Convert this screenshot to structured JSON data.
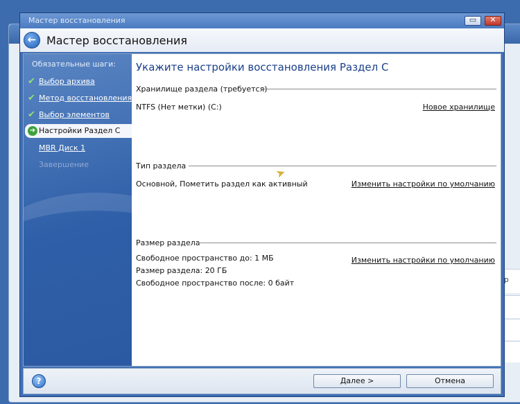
{
  "window": {
    "title": "Мастер восстановления",
    "header_title": "Мастер восстановления"
  },
  "background_window": {
    "fragment": "бр"
  },
  "sidebar": {
    "heading": "Обязательные шаги:",
    "items": [
      {
        "label": "Выбор архива",
        "state": "done"
      },
      {
        "label": "Метод восстановления",
        "state": "done"
      },
      {
        "label": "Выбор элементов",
        "state": "done"
      },
      {
        "label": "Настройки Раздел C",
        "state": "active"
      },
      {
        "label": "MBR Диск 1",
        "state": "pending"
      },
      {
        "label": "Завершение",
        "state": "disabled"
      }
    ]
  },
  "main": {
    "title": "Укажите настройки восстановления Раздел C",
    "storage": {
      "heading": "Хранилище раздела (требуется)",
      "value": "NTFS (Нет метки) (C:)",
      "link": "Новое хранилище"
    },
    "type": {
      "heading": "Тип раздела",
      "value": "Основной, Пометить раздел как активный",
      "link": "Изменить настройки по умолчанию"
    },
    "size": {
      "heading": "Размер раздела",
      "free_before": "Свободное пространство до: 1 МБ",
      "size": "Размер раздела: 20 ГБ",
      "free_after": "Свободное пространство после: 0 байт",
      "link": "Изменить настройки по умолчанию"
    }
  },
  "footer": {
    "next_label": "Далее >",
    "cancel_label": "Отмена"
  },
  "colors": {
    "sidebar": "#2f5fa8",
    "title_text": "#1a3f8a",
    "check": "#8fe36a"
  }
}
